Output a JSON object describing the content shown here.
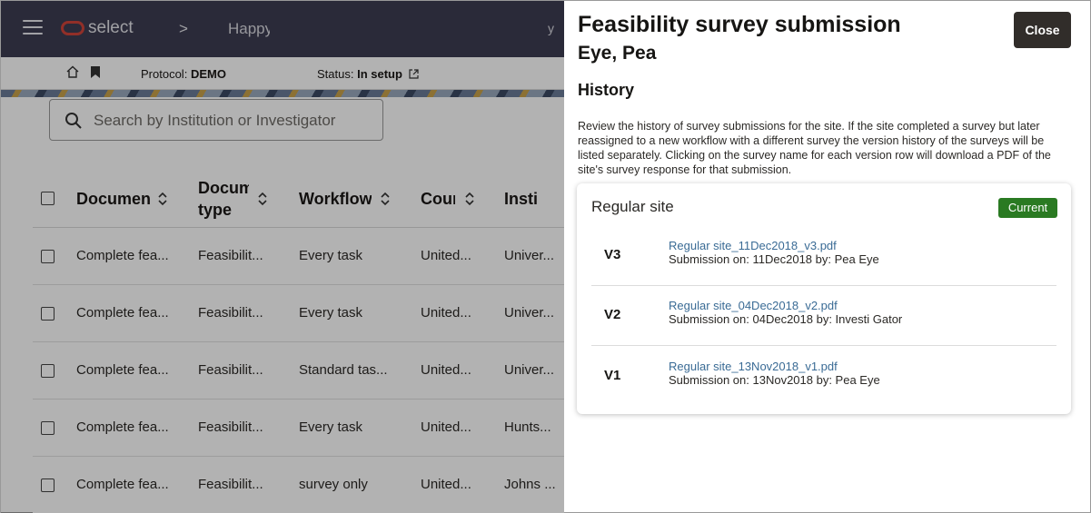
{
  "app": {
    "logo_text": "select",
    "breadcrumb_separator": ">",
    "study_name": "Happy",
    "header_extra": "y",
    "protocol_label": "Protocol:",
    "protocol_value": "DEMO",
    "status_label": "Status:",
    "status_value": "In setup",
    "search_placeholder": "Search by Institution or Investigator",
    "table": {
      "headers": [
        "Documen",
        "Docum\ntype",
        "Workflow",
        "Coun",
        "Insti"
      ],
      "rows": [
        [
          "Complete fea...",
          "Feasibilit...",
          "Every task",
          "United...",
          "Univer..."
        ],
        [
          "Complete fea...",
          "Feasibilit...",
          "Every task",
          "United...",
          "Univer..."
        ],
        [
          "Complete fea...",
          "Feasibilit...",
          "Standard tas...",
          "United...",
          "Univer..."
        ],
        [
          "Complete fea...",
          "Feasibilit...",
          "Every task",
          "United...",
          "Hunts..."
        ],
        [
          "Complete fea...",
          "Feasibilit...",
          "survey only",
          "United...",
          "Johns ..."
        ]
      ]
    }
  },
  "drawer": {
    "title": "Feasibility survey submission",
    "subtitle": "Eye, Pea",
    "close_label": "Close",
    "history_heading": "History",
    "description": "Review the history of survey submissions for the site. If the site completed a survey but later reassigned to a new workflow with a different survey the version history of the surveys will be listed separately. Clicking on the survey name for each version row will download a PDF of the site's survey response for that submission.",
    "card": {
      "title": "Regular site",
      "badge": "Current",
      "versions": [
        {
          "label": "V3",
          "file": "Regular site_11Dec2018_v3.pdf",
          "meta": "Submission on: 11Dec2018 by: Pea Eye"
        },
        {
          "label": "V2",
          "file": "Regular site_04Dec2018_v2.pdf",
          "meta": "Submission on: 04Dec2018 by: Investi Gator"
        },
        {
          "label": "V1",
          "file": "Regular site_13Nov2018_v1.pdf",
          "meta": "Submission on: 13Nov2018 by: Pea Eye"
        }
      ]
    }
  },
  "colors": {
    "topbar": "#3d3d52",
    "badge_green": "#2a7a22",
    "link_blue": "#3a6b95",
    "close_button": "#312d2a"
  }
}
